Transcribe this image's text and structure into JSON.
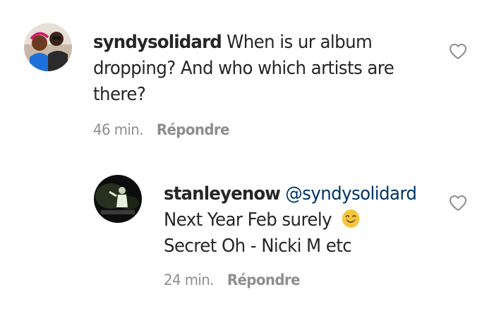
{
  "comments": [
    {
      "username": "syndysolidard",
      "text_line1": "When is ur album",
      "text_line2": "dropping? And who which artists are",
      "text_line3": "there?",
      "time": "46 min.",
      "reply_label": "Répondre",
      "like_icon": "heart-outline-icon"
    },
    {
      "username": "stanleyenow",
      "mention": "@syndysolidard",
      "text_line1": "Next Year Feb surely",
      "emoji": "smiling-face-emoji",
      "text_line2": "Secret Oh - Nicki M etc",
      "time": "24 min.",
      "reply_label": "Répondre",
      "like_icon": "heart-outline-icon"
    }
  ],
  "colors": {
    "text": "#262626",
    "meta": "#8e8e8e",
    "mention": "#003569",
    "heart_stroke": "#8e8e8e",
    "emoji": "#f5c63b"
  }
}
